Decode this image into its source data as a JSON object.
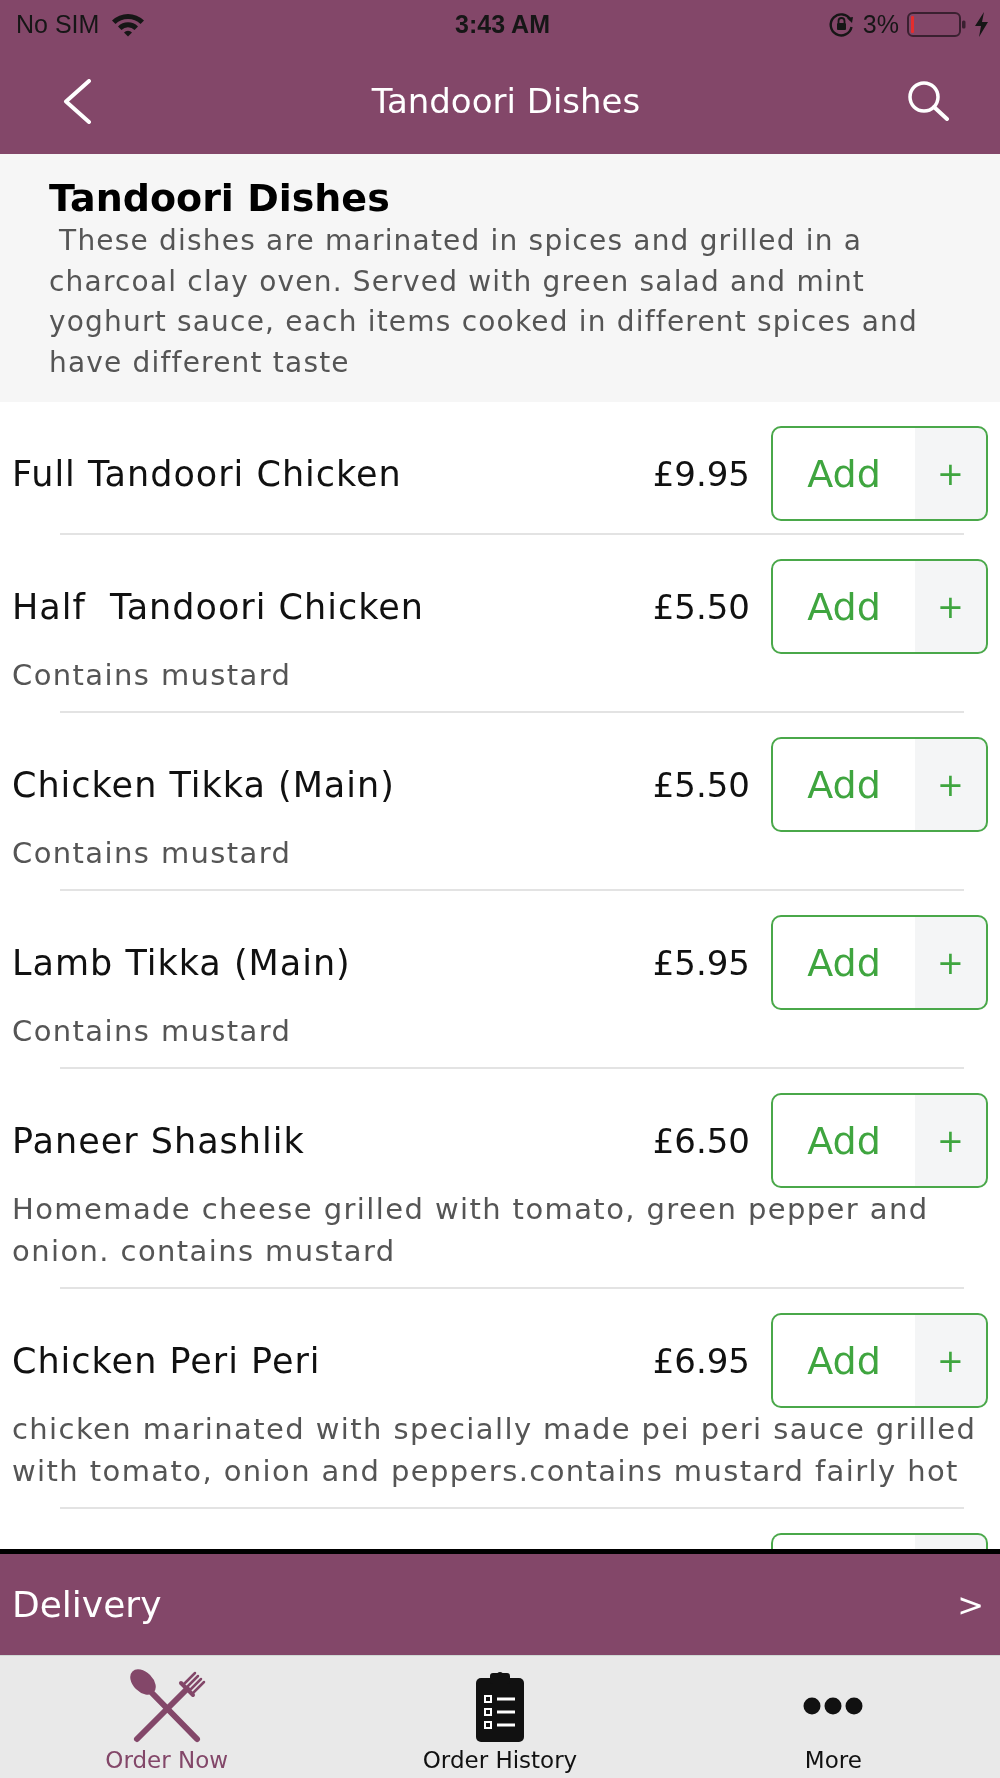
{
  "status_bar": {
    "carrier": "No SIM",
    "time": "3:43 AM",
    "battery": "3%"
  },
  "nav_bar": {
    "title": "Tandoori Dishes"
  },
  "category": {
    "title": "Tandoori Dishes",
    "description": " These dishes are marinated in spices and grilled in a charcoal clay oven. Served with green salad and mint yoghurt sauce, each items cooked in different spices and have different taste"
  },
  "items": [
    {
      "kind": "dish",
      "name": "Full Tandoori Chicken",
      "price": "£9.95",
      "button": "Add",
      "plus": "+"
    },
    {
      "kind": "dish",
      "name": "Half  Tandoori Chicken",
      "price": "£5.50",
      "button": "Add",
      "plus": "+",
      "description": "Contains mustard"
    },
    {
      "kind": "dish",
      "name": "Chicken Tikka (Main)",
      "price": "£5.50",
      "button": "Add",
      "plus": "+",
      "description": "Contains mustard"
    },
    {
      "kind": "dish",
      "name": "Lamb Tikka (Main)",
      "price": "£5.95",
      "button": "Add",
      "plus": "+",
      "description": "Contains mustard"
    },
    {
      "kind": "dish",
      "name": "Paneer Shashlik",
      "price": "£6.50",
      "button": "Add",
      "plus": "+",
      "description": "Homemade cheese grilled with tomato, green pepper and onion. contains mustard"
    },
    {
      "kind": "dish",
      "name": "Chicken Peri Peri",
      "price": "£6.95",
      "button": "Add",
      "plus": "+",
      "description": "chicken marinated with specially made pei peri sauce grilled with tomato, onion and peppers.contains mustard fairly hot"
    },
    {
      "kind": "cut_off"
    }
  ],
  "delivery_bar": {
    "label": "Delivery",
    "arrow": ">"
  },
  "tabs": [
    {
      "label": "Order Now",
      "selected": true
    },
    {
      "label": "Order History",
      "selected": false
    },
    {
      "label": "More",
      "selected": false
    }
  ]
}
